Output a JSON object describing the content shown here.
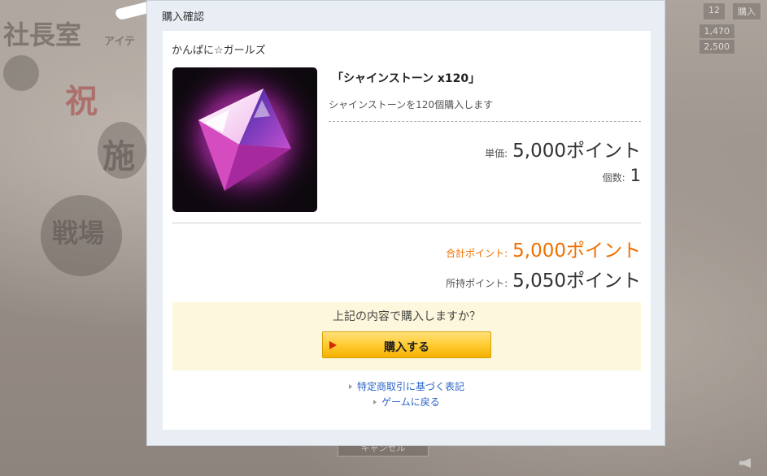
{
  "dialog": {
    "title": "購入確認",
    "game_name": "かんぱに☆ガールズ",
    "item": {
      "icon": "shine-stone-icon",
      "title": "「シャインストーン x120」",
      "description": "シャインストーンを120個購入します"
    },
    "unit_price": {
      "label": "単価:",
      "value": "5,000ポイント"
    },
    "quantity": {
      "label": "個数:",
      "value": "1"
    },
    "total": {
      "label": "合計ポイント:",
      "value": "5,000ポイント"
    },
    "owned": {
      "label": "所持ポイント:",
      "value": "5,050ポイント"
    },
    "confirm": {
      "question": "上記の内容で購入しますか？",
      "button_label": "購入する"
    },
    "links": [
      {
        "label": "特定商取引に基づく表記"
      },
      {
        "label": "ゲームに戻る"
      }
    ]
  },
  "background": {
    "hud": [
      "12",
      "購入",
      "1,470",
      "2,500"
    ],
    "texts": [
      "社長室",
      "祝",
      "施",
      "戦場",
      "アイテ"
    ],
    "cancel_button": "キャンセル"
  },
  "colors": {
    "accent_orange": "#f07000",
    "link_blue": "#2a63c8",
    "button_yellow": "#ffcc33",
    "confirm_bg": "#fdf8dd",
    "dialog_bg": "#e9eef4"
  }
}
